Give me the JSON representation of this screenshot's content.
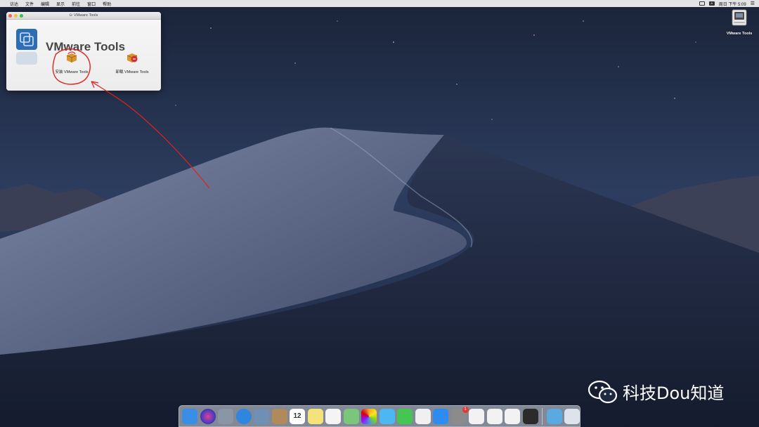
{
  "menubar": {
    "apple_glyph": "",
    "items": [
      "访达",
      "文件",
      "编辑",
      "显示",
      "前往",
      "窗口",
      "帮助"
    ],
    "status_icons": [
      "display-icon",
      "input-a-icon"
    ],
    "clock": "周日 下午 5:09",
    "menu_icon": "list-icon"
  },
  "window": {
    "title": "VMware Tools",
    "heading": "VMware Tools",
    "packages": [
      {
        "label": "安装 VMware Tools",
        "icon": "install-package-icon"
      },
      {
        "label": "卸载 VMware Tools",
        "icon": "uninstall-package-icon"
      }
    ]
  },
  "desktop": {
    "drive_label": "VMware Tools",
    "drive_icon": "disk-drive-icon"
  },
  "watermark": {
    "text": "科技Dou知道",
    "icon": "wechat-icon"
  },
  "dock": {
    "items": [
      {
        "icon": "finder-icon",
        "color": "#3a8ee6"
      },
      {
        "icon": "siri-icon",
        "color": "#6a3fb0"
      },
      {
        "icon": "launchpad-icon",
        "color": "#8a95a5"
      },
      {
        "icon": "safari-icon",
        "color": "#2f86de"
      },
      {
        "icon": "mail-photo-icon",
        "color": "#6f8fb5"
      },
      {
        "icon": "contacts-icon",
        "color": "#b08a5a"
      },
      {
        "icon": "calendar-icon",
        "color": "#ffffff",
        "text": "12"
      },
      {
        "icon": "notes-icon",
        "color": "#f6e27a"
      },
      {
        "icon": "reminders-icon",
        "color": "#f4f4f4"
      },
      {
        "icon": "maps-icon",
        "color": "#7bc67b"
      },
      {
        "icon": "photos-icon",
        "color": "#f2f2f2"
      },
      {
        "icon": "messages-icon",
        "color": "#4cb7f0"
      },
      {
        "icon": "facetime-icon",
        "color": "#45c552"
      },
      {
        "icon": "itunes-icon",
        "color": "#f0f0f0"
      },
      {
        "icon": "app-store-icon",
        "color": "#2e8cf0"
      },
      {
        "icon": "system-preferences-icon",
        "color": "#8b8b8b",
        "badge": "1"
      },
      {
        "icon": "qq-icon",
        "color": "#f2f2f2"
      },
      {
        "icon": "wechat-app-icon",
        "color": "#f2f2f2"
      },
      {
        "icon": "baidu-netdisk-icon",
        "color": "#f2f2f2"
      },
      {
        "icon": "terminal-icon",
        "color": "#2b2b2b"
      }
    ],
    "trailing": [
      {
        "icon": "downloads-folder-icon",
        "color": "#5aa9e0"
      },
      {
        "icon": "trash-icon",
        "color": "#dde3ea"
      }
    ]
  }
}
